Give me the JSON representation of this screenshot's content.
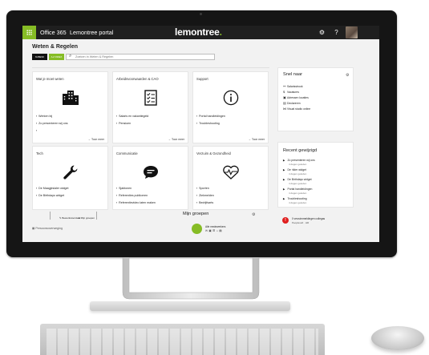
{
  "topbar": {
    "app": "Office 365",
    "portal": "Lemontree portal",
    "logo": "lemontree",
    "logo_dot": ".",
    "gear": "⚙",
    "help": "?"
  },
  "header": {
    "title": "Weten & Regelen",
    "btn_a": "NUBESK",
    "btn_b": "A-Z INDEX",
    "search_placeholder": "Zoeken in Weten & Regelen"
  },
  "tiles": [
    {
      "title": "Wat je moet weten",
      "links": [
        "Werken bij",
        "Zo presenteren wij ons",
        ""
      ],
      "more": "Toon meer"
    },
    {
      "title": "Arbeidsvoorwaarden & CAO",
      "links": [
        "Salaris en vakantiegeld",
        "Pensioen"
      ],
      "more": "Toon meer"
    },
    {
      "title": "Support",
      "links": [
        "Portal handleidingen",
        "Troubleshooting"
      ],
      "more": "Toon meer"
    },
    {
      "title": "Tech",
      "links": [
        "De Maagjeslaler widget",
        "De Birthdays widget"
      ],
      "more": ""
    },
    {
      "title": "Communicatie",
      "links": [
        "Sjablonen",
        "Referenties publiceren",
        "Referentievideo laten maken"
      ],
      "more": ""
    },
    {
      "title": "Verzuim & Gezondheid",
      "links": [
        "Sporten",
        "Ziekmelden",
        "Bedrijfsarts"
      ],
      "more": ""
    }
  ],
  "snel_naar": {
    "title": "Snel naar",
    "gear": "⚙",
    "items": [
      {
        "icon": "link-icon",
        "label": "Salarisstrook"
      },
      {
        "icon": "dollar-icon",
        "label": "Vacatures"
      },
      {
        "icon": "id-card-icon",
        "label": "Adressen locaties"
      },
      {
        "icon": "doc-icon",
        "label": "Declareren"
      },
      {
        "icon": "vs-icon",
        "label": "Visual studio online"
      }
    ]
  },
  "recent": {
    "title": "Recent gewijzigd",
    "items": [
      {
        "name": "Zo presenteren wij ons",
        "sub": "4 dagen geleden"
      },
      {
        "name": "De         ‹ilder widget",
        "sub": "4 dagen geleden"
      },
      {
        "name": "De Birthdays widget",
        "sub": "4 dagen geleden"
      },
      {
        "name": "Portal handleidingen",
        "sub": "4 dagen geleden"
      },
      {
        "name": "Troubleshooting",
        "sub": "4 dagen geleden"
      }
    ]
  },
  "notice": {
    "icon": "!",
    "text": "0 verzuimmeldingen collegas",
    "sub": "Peoplesoft · HR"
  },
  "bottom": {
    "tab_a": "Bewerkstoorden",
    "tab_b": "Mijn groepen",
    "personal": "Persoonsoverweging",
    "my_groups": "Mijn groepen",
    "gear": "⚙",
    "group_name": "Alle medewerkers",
    "group_icons": "✉ ▣ ☰ ⌂ ▤"
  },
  "colors": {
    "accent_green": "#86bc25",
    "topbar": "#1f1f1f",
    "alert_red": "#e01e1e"
  }
}
